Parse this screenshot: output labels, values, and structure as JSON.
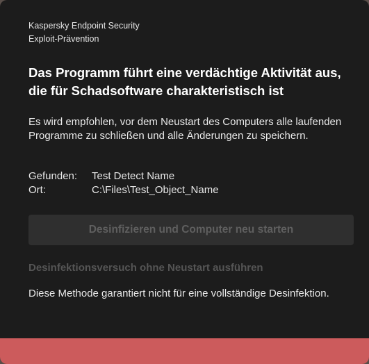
{
  "header": {
    "app_name": "Kaspersky Endpoint Security",
    "component": "Exploit-Prävention"
  },
  "headline": "Das Programm führt eine verdächtige Aktivität aus, die für Schadsoftware charakteristisch ist",
  "advice": "Es wird empfohlen, vor dem Neustart des Computers alle laufenden Programme zu schließen und alle Änderungen zu speichern.",
  "details": {
    "found_label": "Gefunden:",
    "found_value": "Test Detect Name",
    "location_label": "Ort:",
    "location_value": "C:\\Files\\Test_Object_Name"
  },
  "actions": {
    "primary_label": "Desinfizieren und Computer neu starten",
    "secondary_link": "Desinfektionsversuch ohne Neustart ausführen"
  },
  "note": "Diese Methode garantiert nicht für eine vollständige Desinfektion.",
  "colors": {
    "background": "#1c1c1c",
    "accent_bar": "#cc5b5c",
    "disabled_button": "#2f2f2f",
    "disabled_text": "#5f5f5f"
  }
}
